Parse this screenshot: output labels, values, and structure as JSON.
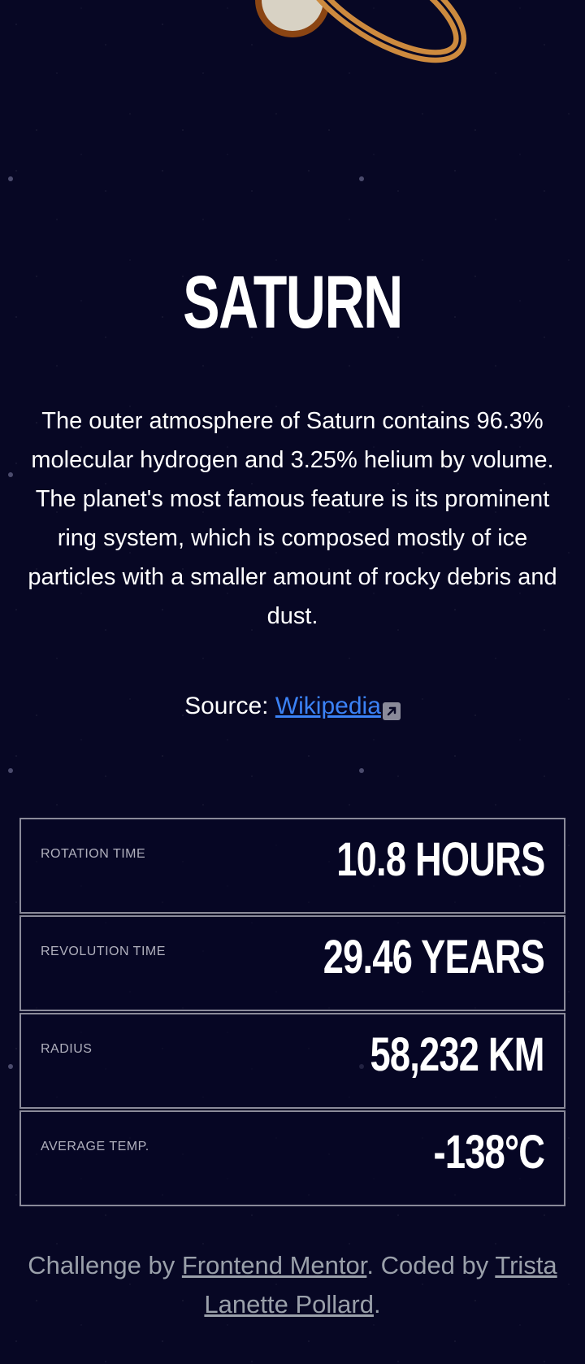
{
  "planet": {
    "name": "SATURN",
    "description": "The outer atmosphere of Saturn contains 96.3% molecular hydrogen and 3.25% helium by volume. The planet's most famous feature is its prominent ring system, which is composed mostly of ice particles with a smaller amount of rocky debris and dust.",
    "source_label": "Source: ",
    "source_link_text": "Wikipedia",
    "source_icon": "external-link-icon"
  },
  "facts": [
    {
      "label": "ROTATION TIME",
      "value": "10.8 HOURS"
    },
    {
      "label": "REVOLUTION TIME",
      "value": "29.46 YEARS"
    },
    {
      "label": "RADIUS",
      "value": "58,232 KM"
    },
    {
      "label": "AVERAGE TEMP.",
      "value": "-138°C"
    }
  ],
  "footer": {
    "prefix": "Challenge by ",
    "challenge_link": "Frontend Mentor",
    "middle": ". Coded by ",
    "author_link": "Trista Lanette Pollard",
    "suffix": "."
  },
  "colors": {
    "background": "#070724",
    "link": "#3b82f6",
    "planet_ring": "#CD8A3E",
    "planet_rim": "#8B4513"
  }
}
